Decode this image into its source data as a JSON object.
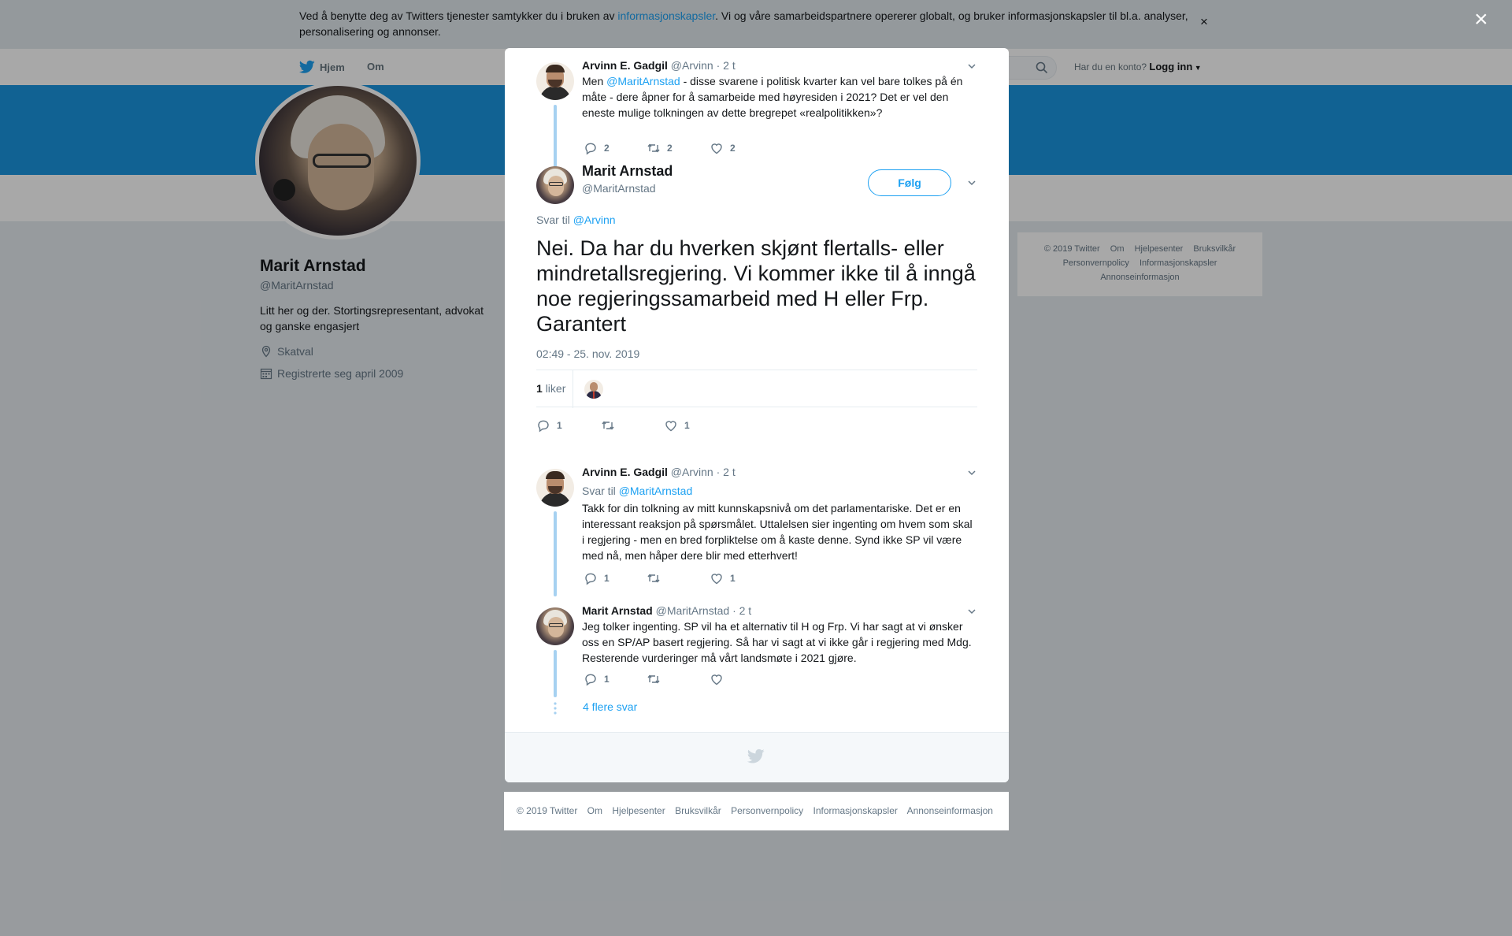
{
  "cookie_banner": {
    "text_before": "Ved å benytte deg av Twitters tjenester samtykker du i bruken av ",
    "link": "informasjonskapsler",
    "text_after": ". Vi og våre samarbeidspartnere opererer globalt, og bruker informasjonskapsler til bl.a. analyser, personalisering og annonser.",
    "close_glyph": "×"
  },
  "overlay_close_glyph": "×",
  "topbar": {
    "home": "Hjem",
    "about": "Om",
    "login_prompt": "Har du en konto?",
    "login": "Logg inn"
  },
  "profile": {
    "name": "Marit Arnstad",
    "handle": "@MaritArnstad",
    "bio": "Litt her og der. Stortingsrepresentant, advokat og ganske engasjert",
    "location": "Skatval",
    "joined": "Registrerte seg april 2009"
  },
  "side_footer": [
    "© 2019 Twitter",
    "Om",
    "Hjelpesenter",
    "Bruksvilkår",
    "Personvernpolicy",
    "Informasjonskapsler",
    "Annonseinformasjon"
  ],
  "modal": {
    "parent_tweet": {
      "name": "Arvinn E. Gadgil",
      "handle": "@Arvinn",
      "time": "· 2 t",
      "text_before": "Men ",
      "mention": "@MaritArnstad",
      "text_after": " - disse svarene i politisk kvarter kan vel bare tolkes på én måte - dere åpner for å samarbeide med høyresiden i 2021?  Det er vel den eneste mulige tolkningen av dette bregrepet «realpolitikken»?",
      "replies": "2",
      "retweets": "2",
      "likes": "2"
    },
    "main_tweet": {
      "name": "Marit Arnstad",
      "handle": "@MaritArnstad",
      "follow": "Følg",
      "reply_to_label": "Svar til ",
      "reply_to": "@Arvinn",
      "text": "Nei. Da har du hverken skjønt flertalls- eller mindretallsregjering. Vi kommer ikke til å inngå noe regjeringssamarbeid med H eller Frp. Garantert",
      "timestamp": "02:49 - 25. nov. 2019",
      "likes_count": "1",
      "likes_label": "liker",
      "replies": "1",
      "retweets": "",
      "likes": "1"
    },
    "replies": [
      {
        "name": "Arvinn E. Gadgil",
        "handle": "@Arvinn",
        "time": "· 2 t",
        "reply_to_label": "Svar til ",
        "reply_to": "@MaritArnstad",
        "text": "Takk for din tolkning av mitt kunnskapsnivå om det parlamentariske. Det er en interessant reaksjon på spørsmålet. Uttalelsen sier ingenting om hvem som skal i regjering - men en bred forpliktelse om å kaste denne. Synd ikke SP vil være med nå, men håper dere blir med etterhvert!",
        "replies": "1",
        "retweets": "",
        "likes": "1"
      },
      {
        "name": "Marit Arnstad",
        "handle": "@MaritArnstad",
        "time": "· 2 t",
        "text": "Jeg tolker ingenting. SP vil ha et alternativ til H og Frp. Vi har sagt at vi ønsker oss en SP/AP basert regjering. Så har vi sagt at vi ikke går i regjering med Mdg. Resterende vurderinger må vårt landsmøte i 2021 gjøre.",
        "replies": "1",
        "retweets": "",
        "likes": ""
      }
    ],
    "show_more": "4 flere svar"
  },
  "bottom_footer": [
    "© 2019 Twitter",
    "Om",
    "Hjelpesenter",
    "Bruksvilkår",
    "Personvernpolicy",
    "Informasjonskapsler",
    "Annonseinformasjon"
  ],
  "colors": {
    "accent": "#1da1f2",
    "banner": "#1b95e0",
    "thread": "#a6d1f1",
    "muted": "#657786"
  }
}
